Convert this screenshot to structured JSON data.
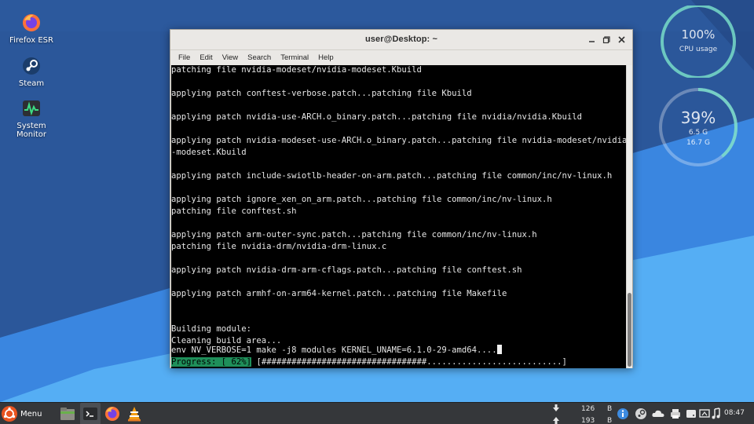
{
  "desktop": {
    "icons": [
      {
        "label": "Firefox ESR",
        "icon": "firefox-icon"
      },
      {
        "label": "Steam",
        "icon": "steam-icon"
      },
      {
        "label": "System Monitor",
        "icon": "system-monitor-icon"
      }
    ],
    "cpu_widget": {
      "value": "100%",
      "label": "CPU usage",
      "level": 1.0
    },
    "mem_widget": {
      "value": "39%",
      "used": "6.5 G",
      "total": "16.7 G",
      "level": 0.39
    }
  },
  "window": {
    "title": "user@Desktop: ~",
    "menu": [
      "File",
      "Edit",
      "View",
      "Search",
      "Terminal",
      "Help"
    ],
    "lines": [
      "patching file nvidia-modeset/nvidia-modeset.Kbuild",
      "",
      "applying patch conftest-verbose.patch...patching file Kbuild",
      "",
      "applying patch nvidia-use-ARCH.o_binary.patch...patching file nvidia/nvidia.Kbuild",
      "",
      "applying patch nvidia-modeset-use-ARCH.o_binary.patch...patching file nvidia-modeset/nvidia",
      "-modeset.Kbuild",
      "",
      "applying patch include-swiotlb-header-on-arm.patch...patching file common/inc/nv-linux.h",
      "",
      "applying patch ignore_xen_on_arm.patch...patching file common/inc/nv-linux.h",
      "patching file conftest.sh",
      "",
      "applying patch arm-outer-sync.patch...patching file common/inc/nv-linux.h",
      "patching file nvidia-drm/nvidia-drm-linux.c",
      "",
      "applying patch nvidia-drm-arm-cflags.patch...patching file conftest.sh",
      "",
      "applying patch armhf-on-arm64-kernel.patch...patching file Makefile",
      "",
      "",
      "Building module:",
      "Cleaning build area...",
      "env NV_VERBOSE=1 make -j8 modules KERNEL_UNAME=6.1.0-29-amd64...."
    ],
    "progress_label": "Progress: [ 62%]",
    "progress_bar": " [#################################...........................]",
    "progress_value": 0.62
  },
  "taskbar": {
    "menu_label": "Menu",
    "net_down": "126",
    "net_down_unit": "B",
    "net_up": "193",
    "net_up_unit": "B",
    "clock": "08:47"
  },
  "colors": {
    "terminal_bg": "#000000",
    "progress_green": "#1f8f5a",
    "desktop_blue": "#2a5298",
    "desktop_light": "#4aa3f0"
  }
}
